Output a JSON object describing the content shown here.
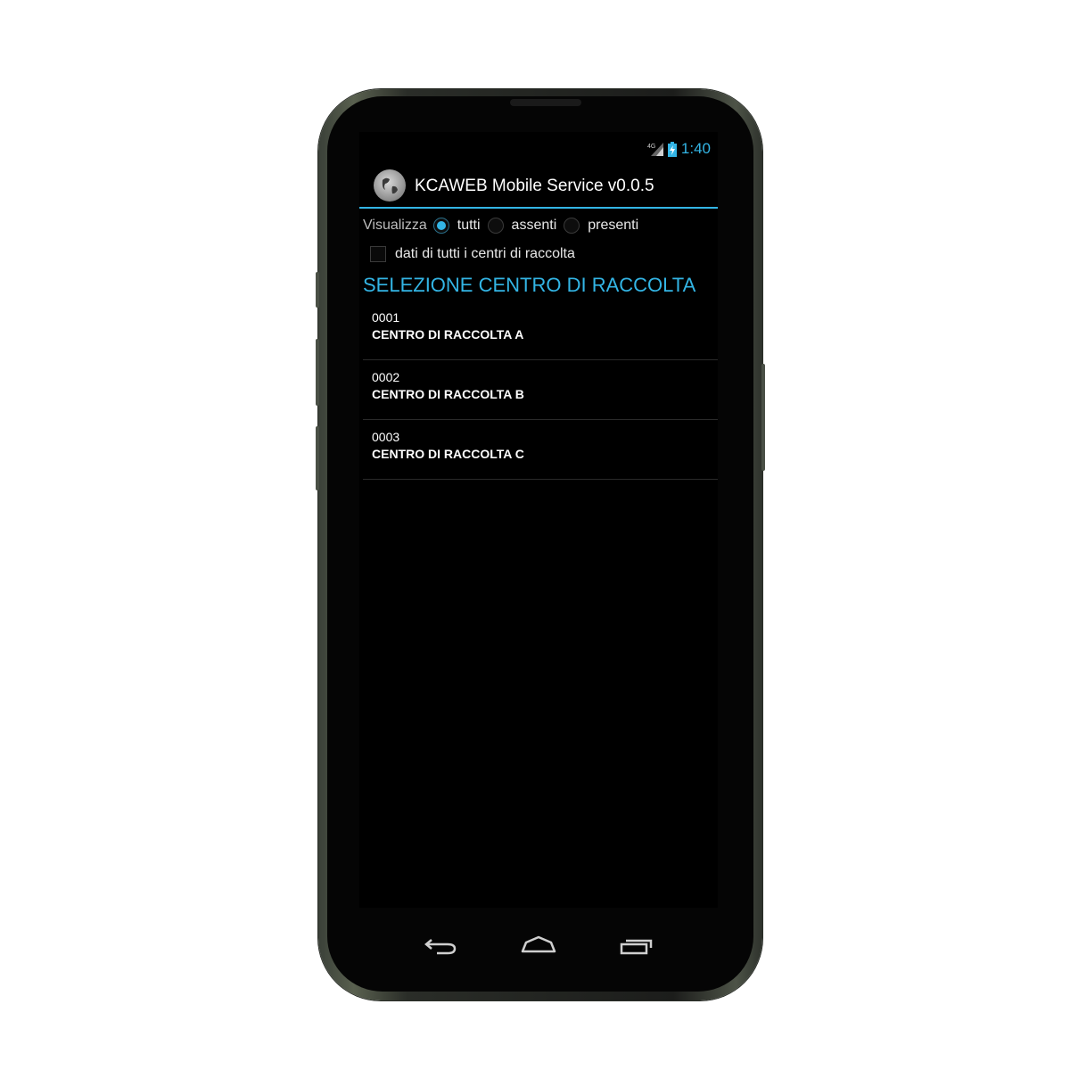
{
  "status_bar": {
    "network": "4G",
    "time": "1:40"
  },
  "action_bar": {
    "title": "KCAWEB Mobile Service v0.0.5",
    "icon": "globe-icon"
  },
  "filter": {
    "label": "Visualizza",
    "options": [
      {
        "label": "tutti",
        "selected": true
      },
      {
        "label": "assenti",
        "selected": false
      },
      {
        "label": "presenti",
        "selected": false
      }
    ]
  },
  "all_centers": {
    "label": "dati di tutti i centri di raccolta",
    "checked": false
  },
  "section_title": "SELEZIONE CENTRO DI RACCOLTA",
  "centers": [
    {
      "code": "0001",
      "name": "CENTRO DI RACCOLTA A"
    },
    {
      "code": "0002",
      "name": "CENTRO DI RACCOLTA B"
    },
    {
      "code": "0003",
      "name": "CENTRO DI RACCOLTA C"
    }
  ],
  "nav": {
    "back": "back-icon",
    "home": "home-icon",
    "recents": "recents-icon"
  },
  "colors": {
    "accent": "#33b5e5",
    "background": "#000000",
    "text": "#ffffff"
  }
}
